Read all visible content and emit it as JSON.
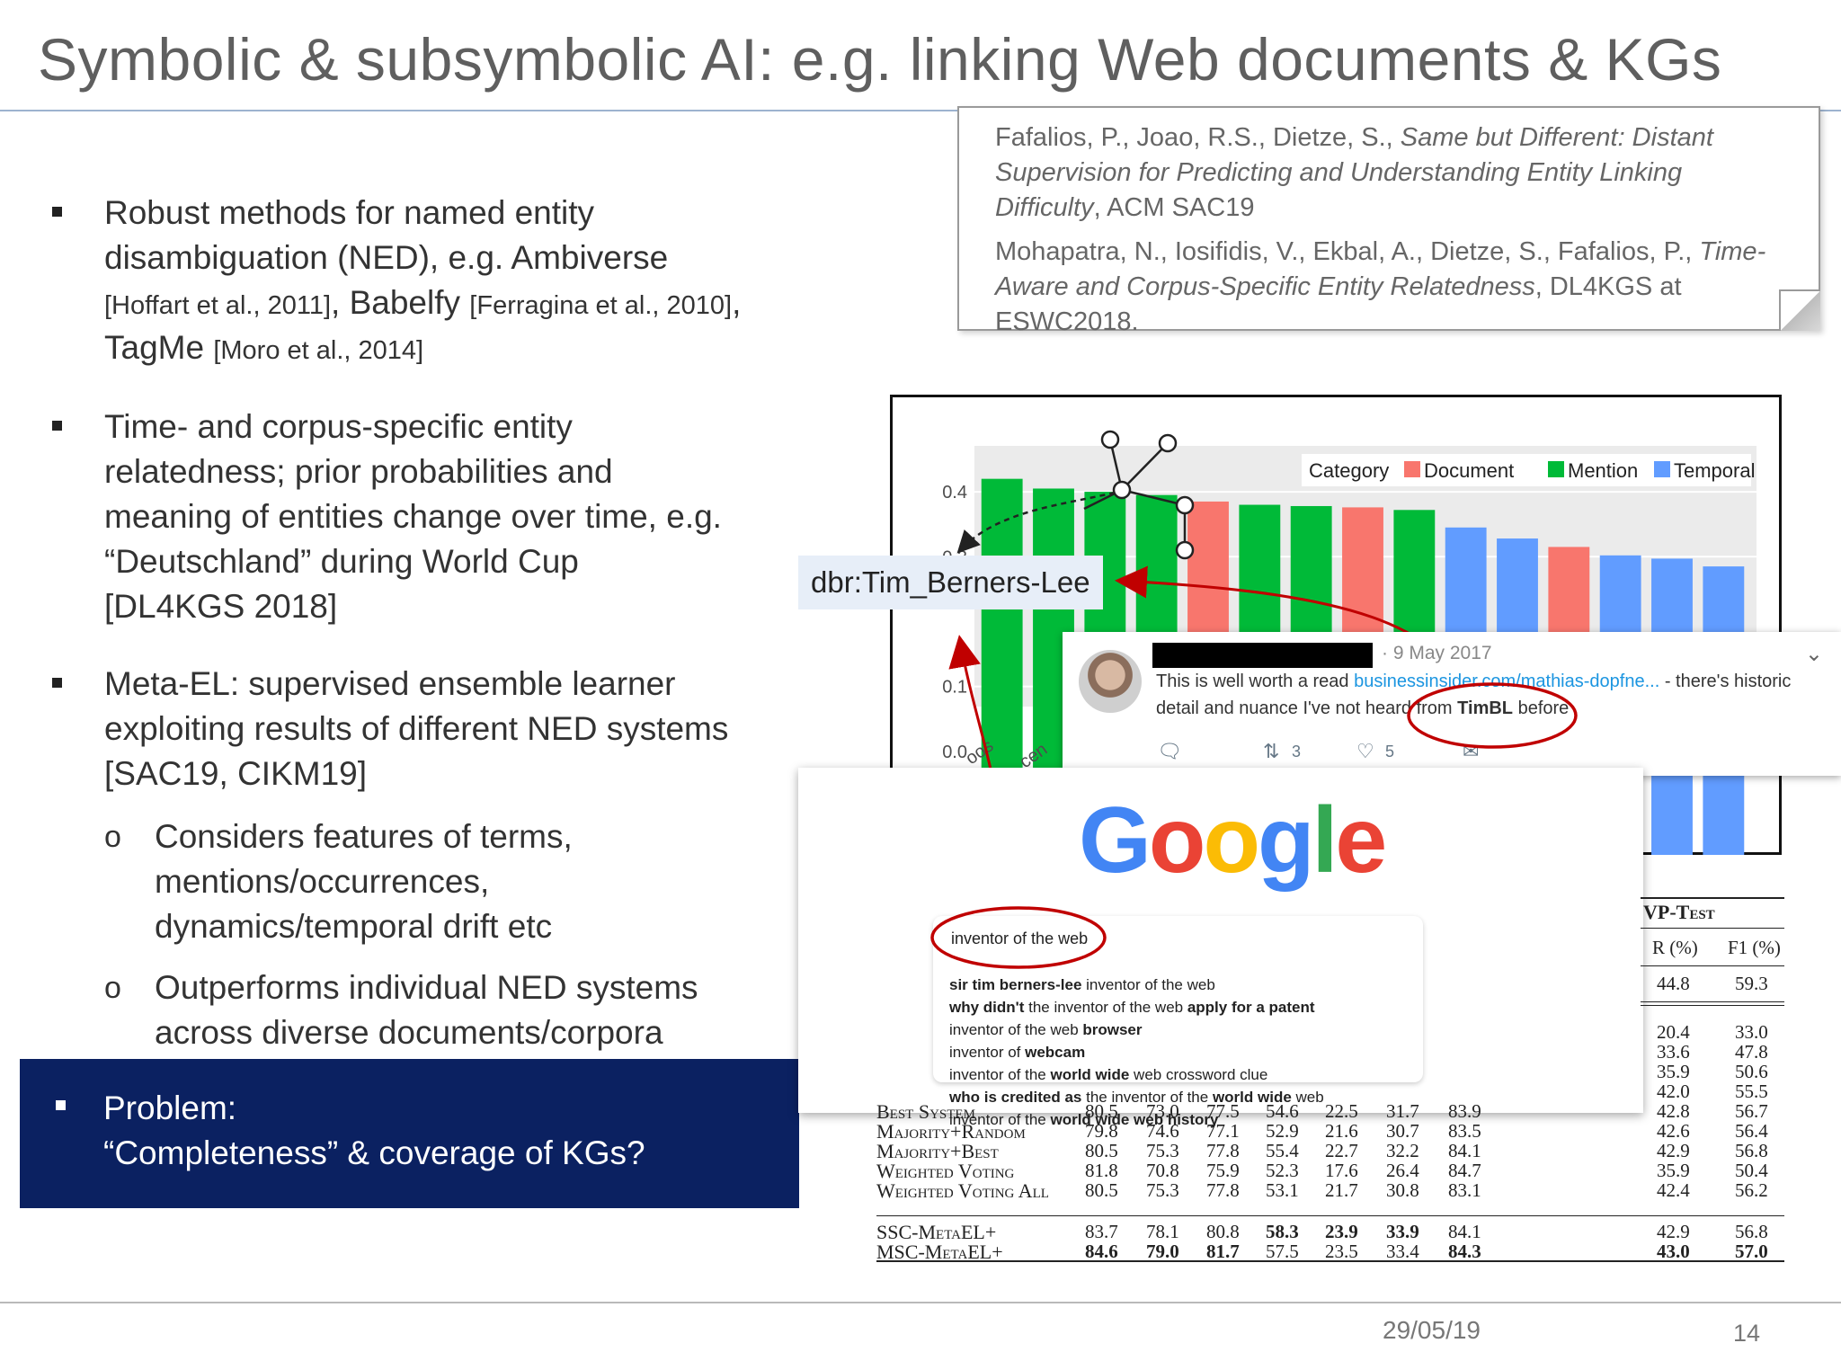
{
  "slide": {
    "title": "Symbolic & subsymbolic AI: e.g. linking Web documents & KGs",
    "date": "29/05/19",
    "page_number": "14"
  },
  "references": [
    {
      "authors": "Fafalios, P., Joao, R.S., Dietze, S., ",
      "title": "Same but Different: Distant Supervision for Predicting and Understanding Entity Linking Difficulty",
      "venue": ", ACM SAC19"
    },
    {
      "authors": "Mohapatra, N., Iosifidis, V., Ekbal, A., Dietze, S., Fafalios, P., ",
      "title": "Time-Aware and Corpus-Specific Entity Relatedness",
      "venue": ", DL4KGS at ESWC2018."
    }
  ],
  "bullets": {
    "b1": {
      "l1": "Robust methods for named entity",
      "l2": "disambiguation (NED), e.g. Ambiverse",
      "l3_cite1": "[Hoffart et al., 2011]",
      "l3_sep": ", Babelfy ",
      "l3_cite2": "[Ferragina et al., 2010]",
      "l3_end": ",",
      "l4_a": "TagMe ",
      "l4_cite": "[Moro et al., 2014]"
    },
    "b2": {
      "l1": "Time- and corpus-specific entity",
      "l2": "relatedness; prior probabilities and",
      "l3": "meaning of entities change over time, e.g.",
      "l4": "“Deutschland” during World Cup",
      "l5": "[DL4KGS 2018]"
    },
    "b3": {
      "l1": "Meta-EL: supervised ensemble learner",
      "l2": "exploiting results of different NED systems",
      "l3": "[SAC19, CIKM19]"
    },
    "sub1": {
      "marker": "o",
      "l1": "Considers features of terms,",
      "l2": "mentions/occurrences,",
      "l3": "dynamics/temporal drift etc"
    },
    "sub2": {
      "marker": "o",
      "l1": "Outperforms individual NED systems",
      "l2": "across diverse documents/corpora"
    },
    "problem": {
      "l1": "Problem:",
      "l2": "“Completeness” & coverage of KGs?"
    }
  },
  "kg_entity_label": "dbr:Tim_Berners-Lee",
  "chart_data": {
    "type": "bar",
    "title": "",
    "xlabel": "",
    "ylabel": "",
    "ylim": [
      0,
      0.45
    ],
    "yticks": [
      "0.0",
      "0.1",
      "0.3",
      "0.4"
    ],
    "legend_title": "Category",
    "legend_position": "top-right",
    "series": [
      {
        "name": "Document",
        "color": "#f8766d"
      },
      {
        "name": "Mention",
        "color": "#00ba38"
      },
      {
        "name": "Temporal",
        "color": "#619cff"
      }
    ],
    "bars": [
      {
        "category": "Mention",
        "value": 0.42
      },
      {
        "category": "Mention",
        "value": 0.405
      },
      {
        "category": "Mention",
        "value": 0.4
      },
      {
        "category": "Mention",
        "value": 0.395
      },
      {
        "category": "Document",
        "value": 0.385
      },
      {
        "category": "Mention",
        "value": 0.38
      },
      {
        "category": "Mention",
        "value": 0.378
      },
      {
        "category": "Document",
        "value": 0.376
      },
      {
        "category": "Mention",
        "value": 0.372
      },
      {
        "category": "Temporal",
        "value": 0.345
      },
      {
        "category": "Temporal",
        "value": 0.328
      },
      {
        "category": "Document",
        "value": 0.315
      },
      {
        "category": "Temporal",
        "value": 0.302
      },
      {
        "category": "Temporal",
        "value": 0.297
      },
      {
        "category": "Temporal",
        "value": 0.285
      }
    ],
    "x_tick_labels_visible": [
      "oos",
      "cen"
    ]
  },
  "tweet": {
    "date": "· 9 May 2017",
    "text1_a": "This is well worth a read ",
    "text1_link": "businessinsider.com/mathias-dopfne...",
    "text1_b": " - there's historic",
    "text2_a": "detail and nuance I've not heard from ",
    "text2_bold": "TimBL",
    "text2_b": " before",
    "retweets": "3",
    "likes": "5"
  },
  "google": {
    "logo_letters": [
      "G",
      "o",
      "o",
      "g",
      "l",
      "e"
    ],
    "logo_colors": [
      "#4285f4",
      "#ea4335",
      "#fbbc05",
      "#4285f4",
      "#34a853",
      "#ea4335"
    ],
    "query": "inventor of the web",
    "suggestions": [
      {
        "b1": "sir tim berners-lee",
        "n1": " inventor of the web",
        "b2": "",
        "n2": ""
      },
      {
        "b1": "why didn't",
        "n1": " the inventor of the web ",
        "b2": "apply for a patent",
        "n2": ""
      },
      {
        "b1": "",
        "n1": "inventor of the web ",
        "b2": "browser",
        "n2": ""
      },
      {
        "b1": "",
        "n1": "inventor of ",
        "b2": "webcam",
        "n2": ""
      },
      {
        "b1": "",
        "n1": "inventor of the ",
        "b2": "world wide",
        "n2": " web crossword clue"
      },
      {
        "b1": "who is credited as",
        "n1": " the inventor of the ",
        "b2": "world wide",
        "n2": " web"
      },
      {
        "b1": "",
        "n1": "inventor of the ",
        "b2": "world wide web history",
        "n2": ""
      }
    ]
  },
  "table": {
    "header_group": "VP-Test",
    "header_cols": [
      "R (%)",
      "F1 (%)"
    ],
    "top_row": [
      "44.8",
      "59.3"
    ],
    "mid_rows": [
      [
        "20.4",
        "33.0"
      ],
      [
        "33.6",
        "47.8"
      ],
      [
        "35.9",
        "50.6"
      ],
      [
        "42.0",
        "55.5"
      ]
    ],
    "rows": [
      {
        "label": "Best System",
        "values": [
          "80.5",
          "73.0",
          "77.5",
          "54.6",
          "22.5",
          "31.7",
          "83.9",
          "42.8",
          "56.7"
        ]
      },
      {
        "label": "Majority+Random",
        "values": [
          "79.8",
          "74.6",
          "77.1",
          "52.9",
          "21.6",
          "30.7",
          "83.5",
          "42.6",
          "56.4"
        ]
      },
      {
        "label": "Majority+Best",
        "values": [
          "80.5",
          "75.3",
          "77.8",
          "55.4",
          "22.7",
          "32.2",
          "84.1",
          "42.9",
          "56.8"
        ]
      },
      {
        "label": "Weighted Voting",
        "values": [
          "81.8",
          "70.8",
          "75.9",
          "52.3",
          "17.6",
          "26.4",
          "84.7",
          "35.9",
          "50.4"
        ]
      },
      {
        "label": "Weighted Voting All",
        "values": [
          "80.5",
          "75.3",
          "77.8",
          "53.1",
          "21.7",
          "30.8",
          "83.1",
          "42.4",
          "56.2"
        ]
      }
    ],
    "meta_rows": [
      {
        "label": "SSC-MetaEL+",
        "values": [
          "83.7",
          "78.1",
          "80.8",
          "58.3",
          "23.9",
          "33.9",
          "84.1",
          "42.9",
          "56.8"
        ]
      },
      {
        "label": "MSC-MetaEL+",
        "values": [
          "84.6",
          "79.0",
          "81.7",
          "57.5",
          "23.5",
          "33.4",
          "84.3",
          "43.0",
          "57.0"
        ]
      }
    ]
  }
}
